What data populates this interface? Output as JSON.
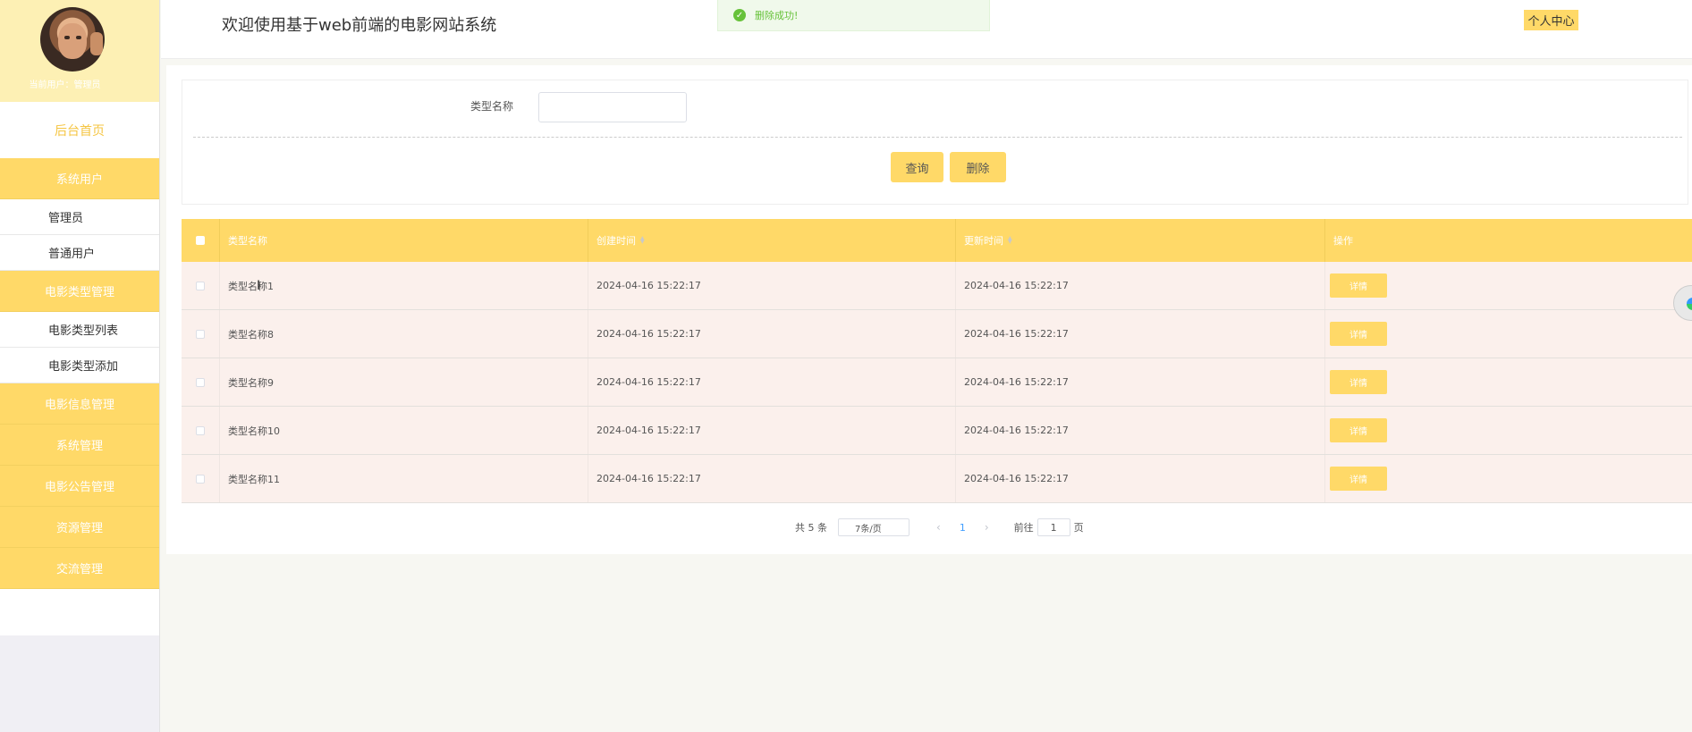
{
  "app": {
    "title": "欢迎使用基于web前端的电影网站系统",
    "personal_center": "个人中心"
  },
  "toast": {
    "message": "删除成功!",
    "icon": "check-circle-icon"
  },
  "sidebar": {
    "user_text": "当前用户：管理员",
    "home": "后台首页",
    "groups": [
      {
        "label": "系统用户",
        "items": [
          "管理员",
          "普通用户"
        ]
      },
      {
        "label": "电影类型管理",
        "items": [
          "电影类型列表",
          "电影类型添加"
        ]
      },
      {
        "label": "电影信息管理",
        "items": []
      },
      {
        "label": "系统管理",
        "items": []
      },
      {
        "label": "电影公告管理",
        "items": []
      },
      {
        "label": "资源管理",
        "items": []
      },
      {
        "label": "交流管理",
        "items": []
      }
    ]
  },
  "search": {
    "label": "类型名称",
    "input_value": "",
    "query_button": "查询",
    "delete_button": "删除"
  },
  "table": {
    "headers": [
      "类型名称",
      "创建时间",
      "更新时间",
      "操作"
    ],
    "detail_label": "详情",
    "rows": [
      {
        "name": "类型名称1",
        "created": "2024-04-16 15:22:17",
        "updated": "2024-04-16 15:22:17"
      },
      {
        "name": "类型名称8",
        "created": "2024-04-16 15:22:17",
        "updated": "2024-04-16 15:22:17"
      },
      {
        "name": "类型名称9",
        "created": "2024-04-16 15:22:17",
        "updated": "2024-04-16 15:22:17"
      },
      {
        "name": "类型名称10",
        "created": "2024-04-16 15:22:17",
        "updated": "2024-04-16 15:22:17"
      },
      {
        "name": "类型名称11",
        "created": "2024-04-16 15:22:17",
        "updated": "2024-04-16 15:22:17"
      }
    ]
  },
  "pagination": {
    "total": "共 5 条",
    "page_size": "7条/页",
    "current_page": "1",
    "goto_label": "前往",
    "goto_value": "1",
    "page_unit": "页"
  },
  "colors": {
    "accent": "#ffd968",
    "sidebar_header": "#fdf0b4",
    "row_bg": "#fbf0ec",
    "success": "#67c23a"
  }
}
